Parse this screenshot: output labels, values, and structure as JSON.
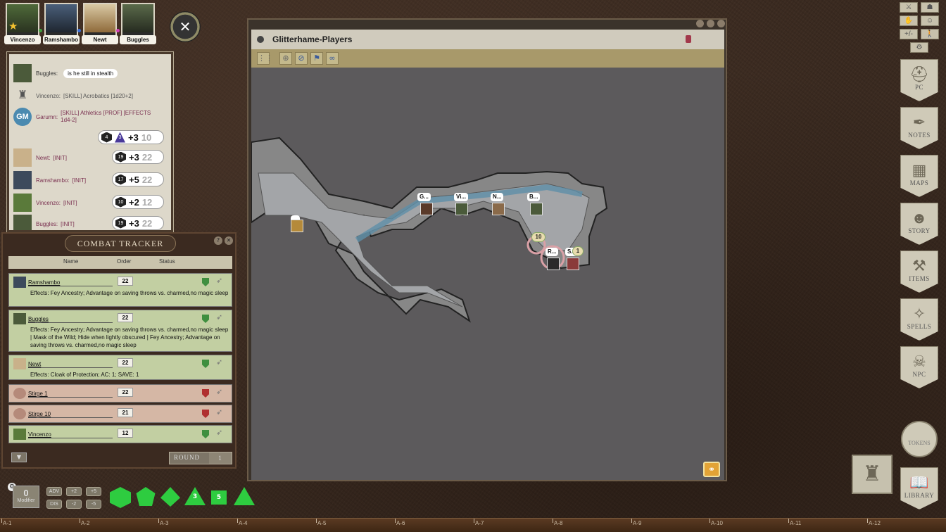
{
  "party": [
    {
      "name": "Vincenzo",
      "dot": "#3f9f3f"
    },
    {
      "name": "Ramshambo",
      "dot": "#3a6fd8"
    },
    {
      "name": "Newt",
      "dot": "#d43fb7"
    },
    {
      "name": "Buggles",
      "dot": ""
    }
  ],
  "chat": {
    "lines": [
      {
        "name": "Buggles:",
        "text": "",
        "bubble": "is he still in stealth"
      },
      {
        "name": "Vincenzo:",
        "text": "[SKILL] Acrobatics [1d20+2]",
        "bubble": ""
      },
      {
        "name": "Garumn:",
        "text": "[SKILL] Athletics [PROF] [EFFECTS 1d4-2]",
        "bubble": "",
        "avatar": "GM"
      },
      {
        "name": "Newt:",
        "text": "[INIT]",
        "bubble": ""
      },
      {
        "name": "Ramshambo:",
        "text": "[INIT]",
        "bubble": ""
      },
      {
        "name": "Vincenzo:",
        "text": "[INIT]",
        "bubble": ""
      },
      {
        "name": "Buggles:",
        "text": "[INIT]",
        "bubble": ""
      }
    ],
    "rolls": [
      {
        "dice": [
          "4",
          "3"
        ],
        "mod": "+3",
        "total": "10"
      },
      {
        "dice": [
          "19"
        ],
        "mod": "+3",
        "total": "22"
      },
      {
        "dice": [
          "17"
        ],
        "mod": "+5",
        "total": "22"
      },
      {
        "dice": [
          "10"
        ],
        "mod": "+2",
        "total": "12"
      },
      {
        "dice": [
          "19"
        ],
        "mod": "+3",
        "total": "22"
      }
    ]
  },
  "combat_tracker": {
    "title": "COMBAT TRACKER",
    "headers": {
      "name": "Name",
      "order": "Order",
      "status": "Status"
    },
    "rows": [
      {
        "name": "Ramshambo",
        "init": "22",
        "faction": "friend",
        "effects": "Effects: Fey Ancestry; Advantage on saving throws vs. charmed,no magic sleep"
      },
      {
        "name": "Buggles",
        "init": "22",
        "faction": "friend",
        "effects": "Effects: Fey Ancestry; Advantage on saving throws vs. charmed,no magic sleep | Mask of the Wild; Hide when lightly obscured | Fey Ancestry; Advantage on saving throws vs. charmed,no magic sleep"
      },
      {
        "name": "Newt",
        "init": "22",
        "faction": "friend",
        "effects": "Effects: Cloak of Protection; AC: 1; SAVE: 1"
      },
      {
        "name": "Stirge 1",
        "init": "22",
        "faction": "foe",
        "effects": ""
      },
      {
        "name": "Stirge 10",
        "init": "21",
        "faction": "foe",
        "effects": ""
      },
      {
        "name": "Vincenzo",
        "init": "12",
        "faction": "friend",
        "effects": ""
      }
    ],
    "round_label": "ROUND",
    "round_value": "1"
  },
  "map": {
    "title": "Glitterhame-Players",
    "tokens": [
      "G...",
      "Vi...",
      "N...",
      "B...",
      "...",
      "R...",
      "S..."
    ],
    "badges": [
      "10",
      "1"
    ]
  },
  "sidebar": {
    "top_buttons": [
      "+/-"
    ],
    "buttons": [
      "PC",
      "NOTES",
      "MAPS",
      "STORY",
      "ITEMS",
      "SPELLS",
      "NPC",
      "TOKENS",
      "LIBRARY"
    ]
  },
  "hotbar": {
    "modifier_value": "0",
    "modifier_label": "Modifier",
    "buttons": [
      "ADV",
      "+2",
      "+5",
      "DIS",
      "-2",
      "-5"
    ],
    "dice": [
      "d20",
      "d12",
      "d10",
      "3",
      "5",
      "d4"
    ]
  },
  "grid_coords": [
    "A-1",
    "A-2",
    "A-3",
    "A-4",
    "A-5",
    "A-6",
    "A-7",
    "A-8",
    "A-9",
    "A-10",
    "A-11",
    "A-12"
  ],
  "colors": {
    "friend_row": "#c2cfa2",
    "foe_row": "#d5b7a5",
    "dice": "#2ecc40",
    "accent": "#a8996a"
  }
}
